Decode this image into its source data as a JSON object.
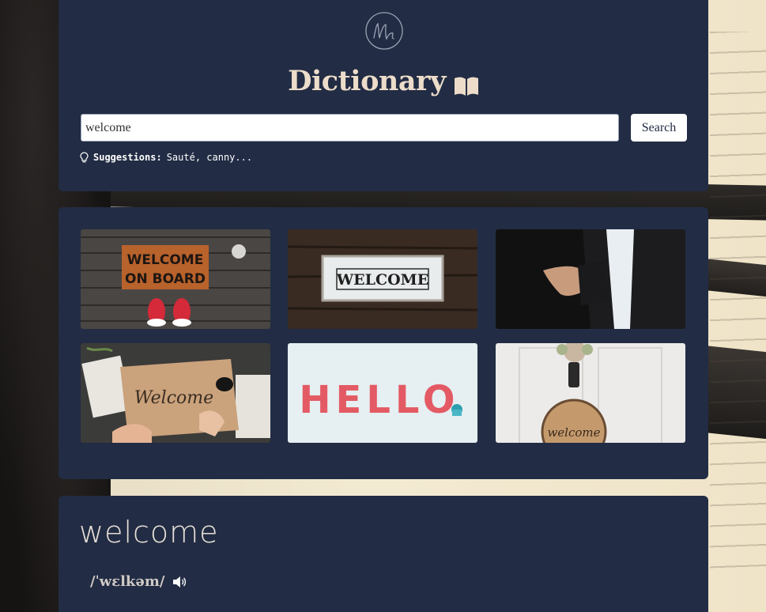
{
  "header": {
    "logo_icon": "signature-m-logo-icon",
    "title": "Dictionary",
    "title_icon": "open-book-icon"
  },
  "search": {
    "value": "welcome",
    "placeholder": "",
    "button_label": "Search"
  },
  "suggestions": {
    "icon": "lightbulb-icon",
    "label": "Suggestions:",
    "text": "Sauté, canny..."
  },
  "images": [
    {
      "description": "welcome-on-board-doormat",
      "mat_text_line1": "WELCOME",
      "mat_text_line2": "ON BOARD"
    },
    {
      "description": "welcome-sign-on-wood",
      "sign_text": "WELCOME"
    },
    {
      "description": "handshake-businessman"
    },
    {
      "description": "welcome-handwriting-on-paper",
      "script_text": "Welcome"
    },
    {
      "description": "hello-clay-letters",
      "letters_text": "HELLO"
    },
    {
      "description": "welcome-door-wreath",
      "script_text": "welcome"
    }
  ],
  "result": {
    "word": "welcome",
    "phonetic": "/ˈwɛlkəm/",
    "audio_icon": "speaker-icon"
  },
  "colors": {
    "card": "#222c44",
    "title": "#ecdcc9",
    "button_bg": "#ffffff"
  }
}
